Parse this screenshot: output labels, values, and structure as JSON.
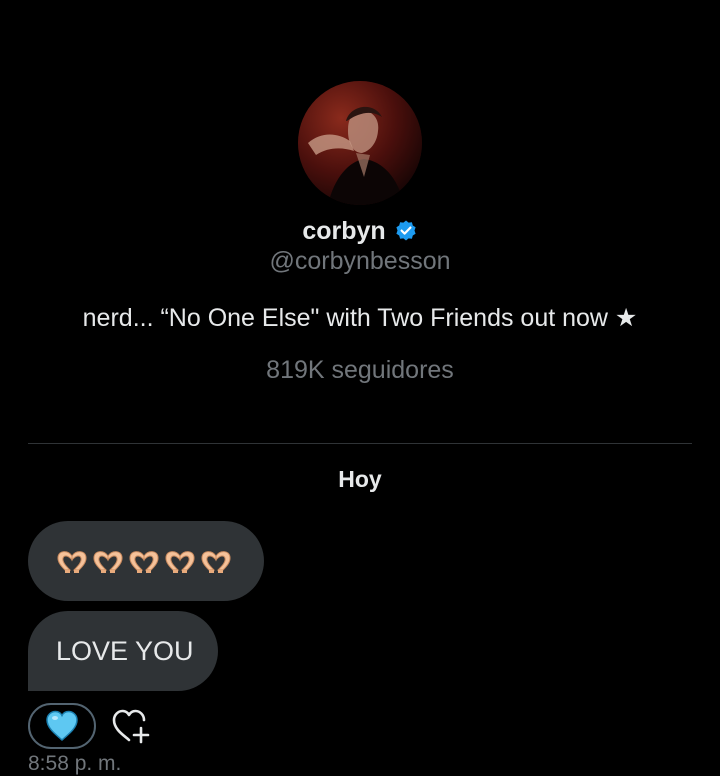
{
  "profile": {
    "display_name": "corbyn",
    "handle": "@corbynbesson",
    "bio": "nerd... “No One Else\" with Two Friends out now ★",
    "followers": "819K seguidores",
    "verified": true,
    "verified_color": "#1d9bf0"
  },
  "conversation": {
    "date_separator": "Hoy",
    "messages": [
      {
        "type": "emoji",
        "icons": [
          "heart-hands-icon",
          "heart-hands-icon",
          "heart-hands-icon",
          "heart-hands-icon",
          "heart-hands-icon"
        ]
      },
      {
        "type": "text",
        "text": "LOVE YOU"
      }
    ],
    "reaction": {
      "icon": "light-blue-heart-icon",
      "color": "#5ec8f2"
    },
    "timestamp": "8:58 p. m."
  },
  "colors": {
    "background": "#000000",
    "bubble": "#2f3336",
    "primary_text": "#e7e9ea",
    "secondary_text": "#71767b"
  }
}
